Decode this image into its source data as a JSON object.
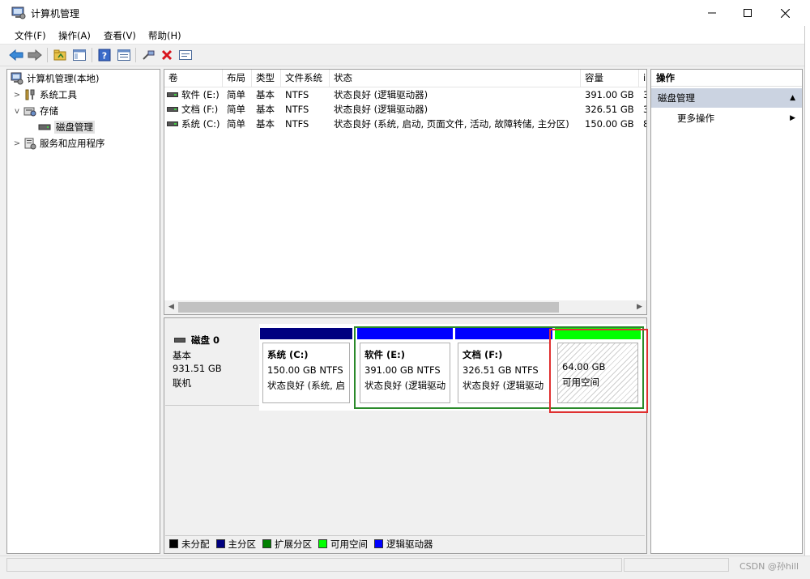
{
  "window": {
    "title": "计算机管理"
  },
  "menu": [
    "文件(F)",
    "操作(A)",
    "查看(V)",
    "帮助(H)"
  ],
  "toolbar": {
    "buttons": [
      "back-icon",
      "forward-icon",
      "up-folder-icon",
      "show-hide-tree-icon",
      "help-icon",
      "properties-icon",
      "connect-icon",
      "delete-icon",
      "console-icon"
    ]
  },
  "tree": {
    "root": "计算机管理(本地)",
    "system_tools": "系统工具",
    "storage": "存储",
    "disk_mgmt": "磁盘管理",
    "services": "服务和应用程序"
  },
  "volumes": {
    "headers": [
      "卷",
      "布局",
      "类型",
      "文件系统",
      "状态",
      "容量",
      "i"
    ],
    "rows": [
      {
        "name": "软件 (E:)",
        "layout": "简单",
        "type": "基本",
        "fs": "NTFS",
        "status": "状态良好 (逻辑驱动器)",
        "capacity": "391.00 GB",
        "extra": "3"
      },
      {
        "name": "文档 (F:)",
        "layout": "简单",
        "type": "基本",
        "fs": "NTFS",
        "status": "状态良好 (逻辑驱动器)",
        "capacity": "326.51 GB",
        "extra": "3"
      },
      {
        "name": "系统 (C:)",
        "layout": "简单",
        "type": "基本",
        "fs": "NTFS",
        "status": "状态良好 (系统, 启动, 页面文件, 活动, 故障转储, 主分区)",
        "capacity": "150.00 GB",
        "extra": "8"
      }
    ]
  },
  "disk": {
    "name": "磁盘 0",
    "type": "基本",
    "size": "931.51 GB",
    "state": "联机",
    "partitions": [
      {
        "name": "系统 (C:)",
        "size": "150.00 GB NTFS",
        "status": "状态良好 (系统, 启",
        "color": "#000080"
      },
      {
        "name": "软件 (E:)",
        "size": "391.00 GB NTFS",
        "status": "状态良好 (逻辑驱动",
        "color": "#0000ff"
      },
      {
        "name": "文档 (F:)",
        "size": "326.51 GB NTFS",
        "status": "状态良好 (逻辑驱动",
        "color": "#0000ff"
      },
      {
        "name": "",
        "size": "64.00 GB",
        "status": "可用空间",
        "color": "#00ff00"
      }
    ]
  },
  "legend": [
    {
      "label": "未分配",
      "color": "#000000"
    },
    {
      "label": "主分区",
      "color": "#000080"
    },
    {
      "label": "扩展分区",
      "color": "#008000"
    },
    {
      "label": "可用空间",
      "color": "#00ff00"
    },
    {
      "label": "逻辑驱动器",
      "color": "#0000ff"
    }
  ],
  "actions": {
    "title": "操作",
    "section": "磁盘管理",
    "item": "更多操作"
  },
  "watermark": "CSDN @孙hill"
}
